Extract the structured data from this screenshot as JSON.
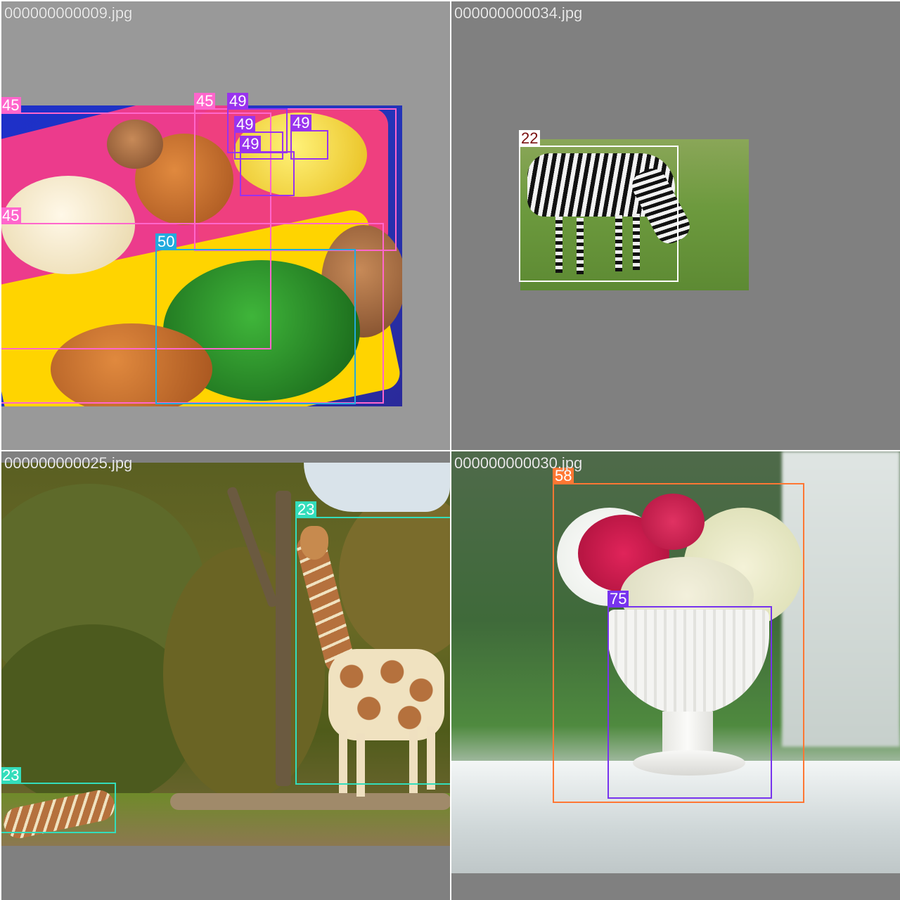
{
  "tiles": [
    {
      "filename": "000000000009.jpg",
      "detections": [
        {
          "label": "45",
          "color": "#ff66cc"
        },
        {
          "label": "45",
          "color": "#ff66cc"
        },
        {
          "label": "49",
          "color": "#9933ee"
        },
        {
          "label": "49",
          "color": "#9933ee"
        },
        {
          "label": "49",
          "color": "#9933ee"
        },
        {
          "label": "49",
          "color": "#9933ee"
        },
        {
          "label": "45",
          "color": "#ff66cc"
        },
        {
          "label": "50",
          "color": "#22aadd"
        }
      ]
    },
    {
      "filename": "000000000034.jpg",
      "detections": [
        {
          "label": "22",
          "color": "#ffffff",
          "label_text_color": "#7a1010"
        }
      ]
    },
    {
      "filename": "000000000025.jpg",
      "detections": [
        {
          "label": "23",
          "color": "#33ddbb"
        },
        {
          "label": "23",
          "color": "#33ddbb"
        }
      ]
    },
    {
      "filename": "000000000030.jpg",
      "detections": [
        {
          "label": "58",
          "color": "#ff7733"
        },
        {
          "label": "75",
          "color": "#7733ee"
        }
      ]
    }
  ]
}
